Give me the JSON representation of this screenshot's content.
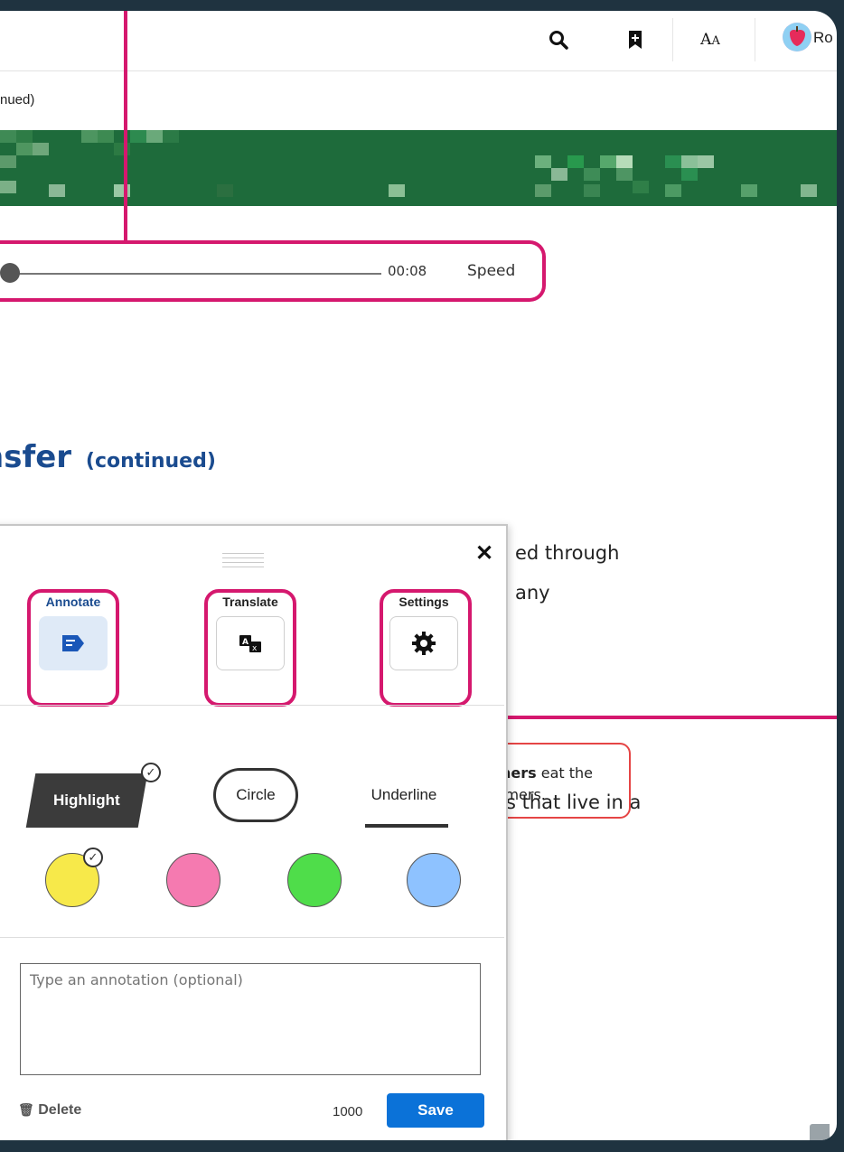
{
  "header": {
    "user_name": "Ro",
    "search_icon": "search-icon",
    "bookmark_icon": "bookmark-add-icon",
    "text_size_icon": "text-size-icon"
  },
  "breadcrumb": "nued)",
  "audio": {
    "time": "00:08",
    "speed_label": "Speed",
    "progress_fraction": 0.0
  },
  "section": {
    "title": "nsfer",
    "subtitle": "(continued)"
  },
  "body_text": {
    "line1": "ed through",
    "line2": "any",
    "line3": "s that live in a"
  },
  "key_box": {
    "bold": "ners",
    "rest1": " eat the",
    "line2": "ımers."
  },
  "panel": {
    "close_label": "✕",
    "tools": {
      "annotate": "Annotate",
      "translate": "Translate",
      "settings": "Settings"
    },
    "styles": {
      "highlight": "Highlight",
      "circle": "Circle",
      "underline": "Underline"
    },
    "colors": [
      "#f7e94a",
      "#f57ab0",
      "#4fdd4a",
      "#8ec2ff"
    ],
    "annotation_placeholder": "Type an annotation (optional)",
    "delete_label": "Delete",
    "char_count": "1000",
    "save_label": "Save"
  },
  "accent": {
    "callout": "#d5186e",
    "heading": "#1a4b8f",
    "save": "#0b72d8",
    "banner": "#1e6b3b"
  }
}
